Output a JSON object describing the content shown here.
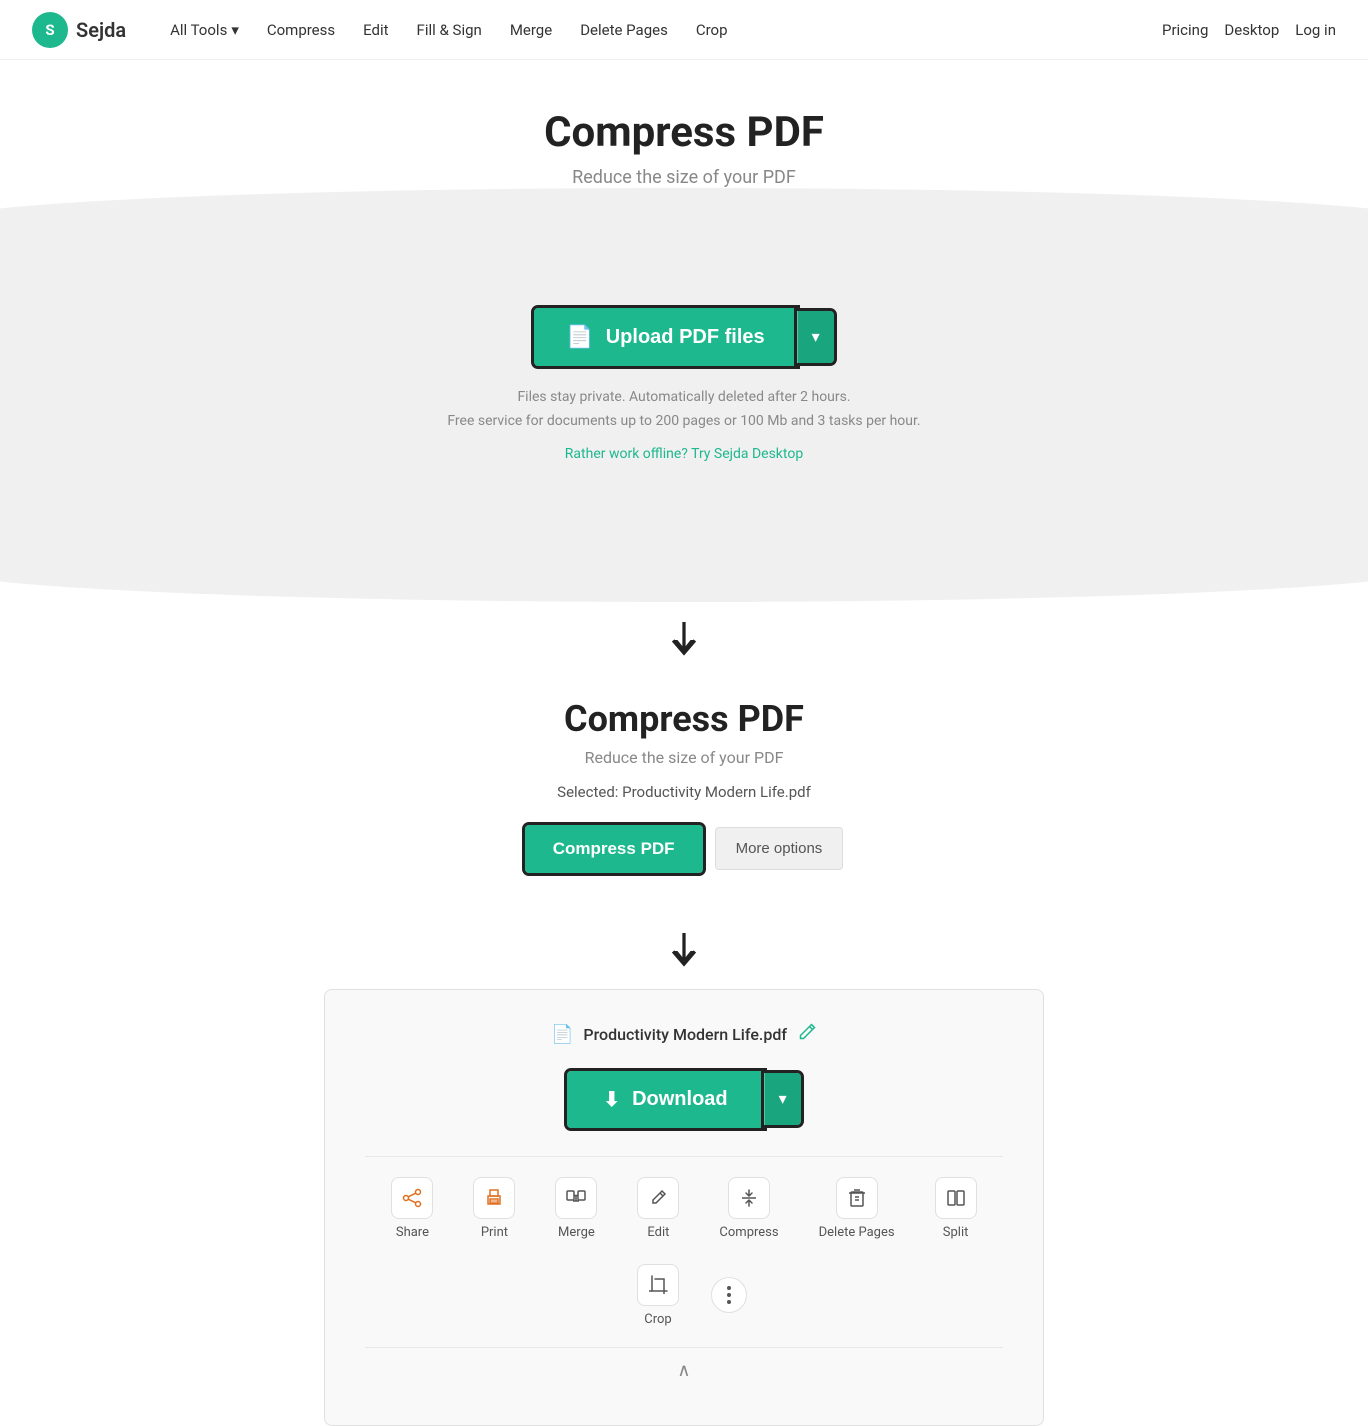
{
  "nav": {
    "logo_letter": "S",
    "logo_name": "Sejda",
    "links": [
      {
        "label": "All Tools",
        "has_arrow": true
      },
      {
        "label": "Compress"
      },
      {
        "label": "Edit"
      },
      {
        "label": "Fill & Sign"
      },
      {
        "label": "Merge"
      },
      {
        "label": "Delete Pages"
      },
      {
        "label": "Crop"
      }
    ],
    "right_links": [
      {
        "label": "Pricing",
        "key": "pricing"
      },
      {
        "label": "Desktop",
        "key": "desktop"
      },
      {
        "label": "Log in",
        "key": "login"
      }
    ]
  },
  "hero": {
    "title": "Compress PDF",
    "subtitle": "Reduce the size of your PDF"
  },
  "upload": {
    "btn_label": "Upload PDF files",
    "info_line1": "Files stay private. Automatically deleted after 2 hours.",
    "info_line2": "Free service for documents up to 200 pages or 100 Mb and 3 tasks per hour.",
    "offline_text": "Rather work offline? Try Sejda Desktop"
  },
  "compress_section": {
    "title": "Compress PDF",
    "subtitle": "Reduce the size of your PDF",
    "selected_file": "Selected: Productivity Modern Life.pdf",
    "compress_btn": "Compress PDF",
    "more_options_btn": "More options"
  },
  "result": {
    "file_name": "Productivity Modern Life.pdf",
    "download_btn": "Download"
  },
  "actions": [
    {
      "key": "share",
      "label": "Share",
      "icon": "share"
    },
    {
      "key": "print",
      "label": "Print",
      "icon": "print"
    },
    {
      "key": "merge",
      "label": "Merge",
      "icon": "merge"
    },
    {
      "key": "edit",
      "label": "Edit",
      "icon": "edit"
    },
    {
      "key": "compress",
      "label": "Compress",
      "icon": "compress"
    },
    {
      "key": "delete-pages",
      "label": "Delete Pages",
      "icon": "delete"
    },
    {
      "key": "split",
      "label": "Split",
      "icon": "split"
    },
    {
      "key": "crop",
      "label": "Crop",
      "icon": "crop"
    }
  ]
}
